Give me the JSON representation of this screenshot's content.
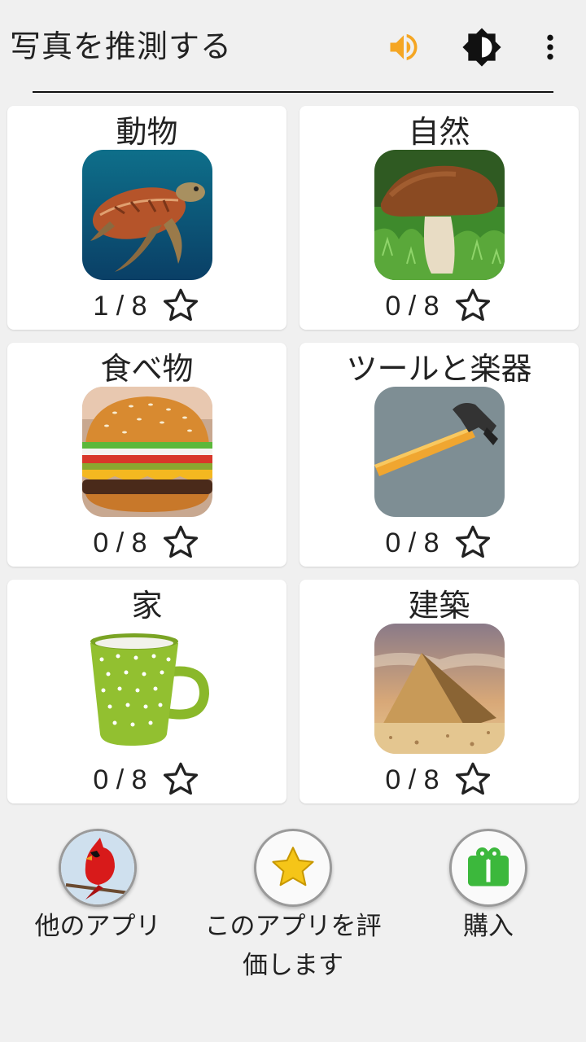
{
  "header": {
    "title": "写真を推測する",
    "sound_icon": "volume-icon",
    "theme_icon": "brightness-icon",
    "menu_icon": "more-vert-icon",
    "accent_color": "#f5a623"
  },
  "categories": [
    {
      "title": "動物",
      "image": "sea-turtle",
      "progress": "1 / 8"
    },
    {
      "title": "自然",
      "image": "mushroom",
      "progress": "0 / 8"
    },
    {
      "title": "食べ物",
      "image": "hamburger",
      "progress": "0 / 8"
    },
    {
      "title": "ツールと楽器",
      "image": "hammer",
      "progress": "0 / 8"
    },
    {
      "title": "家",
      "image": "green-mug",
      "progress": "0 / 8"
    },
    {
      "title": "建築",
      "image": "pyramid",
      "progress": "0 / 8"
    }
  ],
  "bottom": {
    "other_apps_label": "他のアプリ",
    "rate_label_line1": "このアプリを評",
    "rate_label_line2": "価します",
    "purchase_label": "購入"
  }
}
